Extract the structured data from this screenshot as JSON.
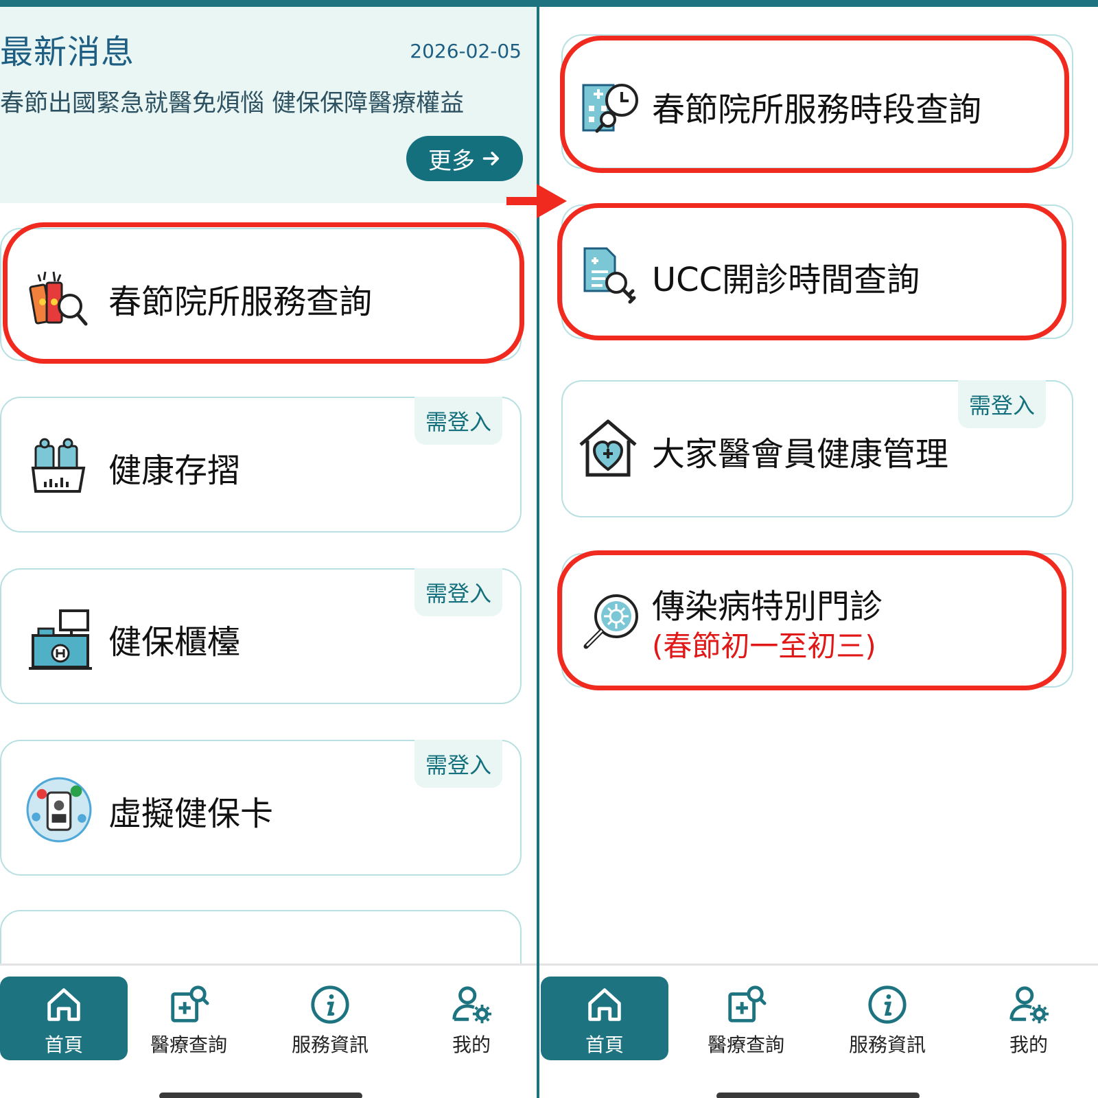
{
  "news": {
    "title": "最新消息",
    "date": "2026-02-05",
    "headline": "春節出國緊急就醫免煩惱 健保保障醫療權益",
    "more_label": "更多"
  },
  "left_cards": [
    {
      "label": "春節院所服務查詢",
      "icon": "firecracker-search-icon",
      "login_badge": ""
    },
    {
      "label": "健康存摺",
      "icon": "health-passbook-icon",
      "login_badge": "需登入"
    },
    {
      "label": "健保櫃檯",
      "icon": "counter-hospital-icon",
      "login_badge": "需登入"
    },
    {
      "label": "虛擬健保卡",
      "icon": "virtual-card-icon",
      "login_badge": "需登入"
    }
  ],
  "right_cards": [
    {
      "label": "春節院所服務時段查詢",
      "icon": "hospital-clock-search-icon",
      "login_badge": ""
    },
    {
      "label": "UCC開診時間查詢",
      "icon": "document-search-icon",
      "login_badge": ""
    },
    {
      "label": "大家醫會員健康管理",
      "icon": "house-heart-icon",
      "login_badge": "需登入"
    },
    {
      "label": "傳染病特別門診",
      "sublabel": "(春節初一至初三)",
      "icon": "virus-search-icon",
      "login_badge": ""
    }
  ],
  "nav": {
    "items": [
      {
        "label": "首頁",
        "icon": "home-icon",
        "active": true
      },
      {
        "label": "醫療查詢",
        "icon": "medical-search-icon",
        "active": false
      },
      {
        "label": "服務資訊",
        "icon": "info-icon",
        "active": false
      },
      {
        "label": "我的",
        "icon": "user-settings-icon",
        "active": false
      }
    ]
  },
  "colors": {
    "primary": "#1d7480",
    "highlight": "#f02a1e",
    "news_bg": "#e9f6f4",
    "card_border": "#b8e0e2",
    "news_text": "#1d5e82"
  }
}
